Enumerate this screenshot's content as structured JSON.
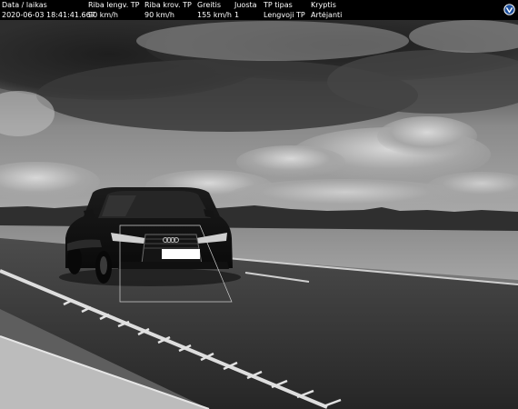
{
  "overlay": {
    "columns": [
      {
        "label": "Data / laikas",
        "value": "2020-06-03 18:41:41.667"
      },
      {
        "label": "Riba lengv. TP",
        "value": "90 km/h"
      },
      {
        "label": "Riba krov. TP",
        "value": "90 km/h"
      },
      {
        "label": "Greitis",
        "value": "155 km/h"
      },
      {
        "label": "Juosta",
        "value": "1"
      },
      {
        "label": "TP tipas",
        "value": "Lengvoji TP"
      },
      {
        "label": "Kryptis",
        "value": "Artėjanti"
      }
    ],
    "logo_icon": "shield-checkmark-icon"
  },
  "scene": {
    "description_icon": "car-on-highway-photo",
    "tone": "grayscale"
  }
}
